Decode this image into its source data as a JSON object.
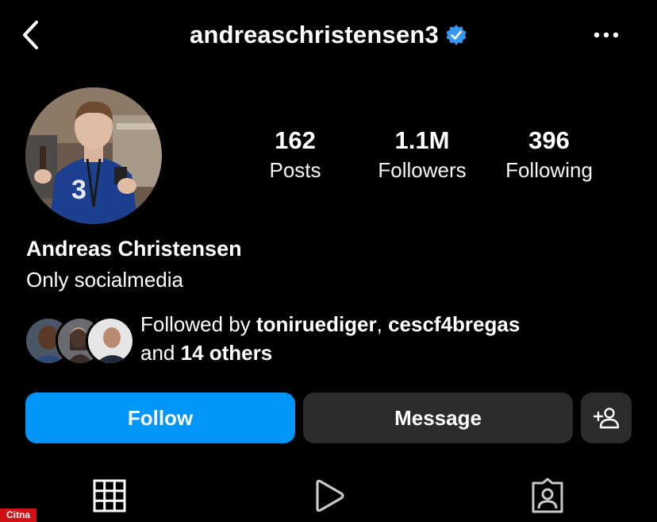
{
  "header": {
    "username": "andreaschristensen3",
    "back_icon": "chevron-left-icon",
    "more_icon": "more-horizontal-icon",
    "verified_color": "#3897f0"
  },
  "stats": [
    {
      "value": "162",
      "label": "Posts"
    },
    {
      "value": "1.1M",
      "label": "Followers"
    },
    {
      "value": "396",
      "label": "Following"
    }
  ],
  "profile": {
    "name": "Andreas Christensen",
    "bio": "Only socialmedia"
  },
  "followed_by": {
    "prefix": "Followed by ",
    "user1": "toniruediger",
    "separator": ", ",
    "user2": "cescf4bregas",
    "and_text": "and ",
    "others": "14 others"
  },
  "actions": {
    "follow": "Follow",
    "message": "Message",
    "add_icon": "add-person-icon"
  },
  "tabs": [
    {
      "icon": "grid-icon"
    },
    {
      "icon": "reels-icon"
    },
    {
      "icon": "tagged-icon"
    }
  ],
  "colors": {
    "follow": "#0095f6",
    "secondary_button": "#2b2b2b",
    "background": "#000000"
  },
  "watermark": "Citna"
}
